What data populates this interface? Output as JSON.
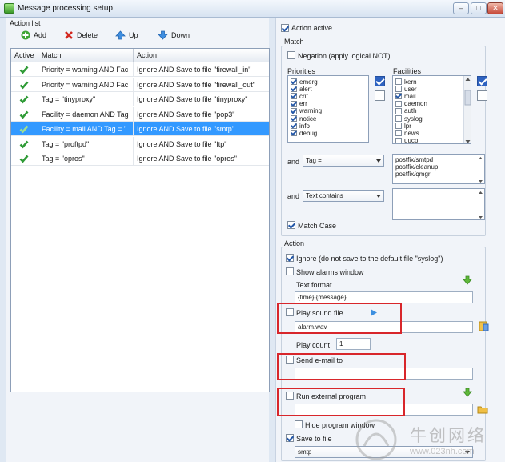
{
  "window": {
    "title": "Message processing setup",
    "min": "–",
    "max": "□",
    "close": "✕"
  },
  "left": {
    "section_label": "Action list",
    "toolbar": {
      "add": "Add",
      "delete": "Delete",
      "up": "Up",
      "down": "Down"
    },
    "columns": [
      "Active",
      "Match",
      "Action"
    ],
    "rows": [
      {
        "match": "Priority = warning AND Fac",
        "action": "Ignore AND Save to file \"firewall_in\"",
        "active": true,
        "selected": false
      },
      {
        "match": "Priority = warning AND Fac",
        "action": "Ignore AND Save to file \"firewall_out\"",
        "active": true,
        "selected": false
      },
      {
        "match": "Tag = \"tinyproxy\"",
        "action": "Ignore AND Save to file \"tinyproxy\"",
        "active": true,
        "selected": false
      },
      {
        "match": "Facility = daemon AND Tag",
        "action": "Ignore AND Save to file \"pop3\"",
        "active": true,
        "selected": false
      },
      {
        "match": "Facility = mail AND Tag = \"",
        "action": "Ignore AND Save to file \"smtp\"",
        "active": true,
        "selected": true
      },
      {
        "match": "Tag = \"proftpd\"",
        "action": "Ignore AND Save to file \"ftp\"",
        "active": true,
        "selected": false
      },
      {
        "match": "Tag = \"opros\"",
        "action": "Ignore AND Save to file \"opros\"",
        "active": true,
        "selected": false
      }
    ]
  },
  "right": {
    "action_active": "Action active",
    "match_label": "Match",
    "negation": "Negation (apply logical NOT)",
    "priorities_label": "Priorities",
    "priorities": [
      {
        "label": "emerg",
        "on": true
      },
      {
        "label": "alert",
        "on": true
      },
      {
        "label": "crit",
        "on": true
      },
      {
        "label": "err",
        "on": true
      },
      {
        "label": "warning",
        "on": true
      },
      {
        "label": "notice",
        "on": true
      },
      {
        "label": "info",
        "on": true
      },
      {
        "label": "debug",
        "on": true
      }
    ],
    "facilities_label": "Facilities",
    "facilities": [
      {
        "label": "kern",
        "on": false
      },
      {
        "label": "user",
        "on": false
      },
      {
        "label": "mail",
        "on": true
      },
      {
        "label": "daemon",
        "on": false
      },
      {
        "label": "auth",
        "on": false
      },
      {
        "label": "syslog",
        "on": false
      },
      {
        "label": "lpr",
        "on": false
      },
      {
        "label": "news",
        "on": false
      },
      {
        "label": "uucp",
        "on": false
      }
    ],
    "and1": "and",
    "tag_select": "Tag =",
    "tag_values": [
      "postfix/smtpd",
      "postfix/cleanup",
      "postfix/qmgr"
    ],
    "and2": "and",
    "text_select": "Text contains",
    "match_case": "Match Case",
    "action_label": "Action",
    "ignore": "Ignore (do not save to the default file \"syslog\")",
    "show_alarms": "Show alarms window",
    "text_format_label": "Text format",
    "text_format_value": "{time} {message}",
    "play_sound": "Play sound file",
    "sound_file": "alarm.wav",
    "play_count_label": "Play count",
    "play_count": "1",
    "send_email": "Send e-mail to",
    "run_program": "Run external program",
    "hide_window": "Hide program window",
    "save_to_file": "Save to file",
    "save_file_value": "smtp"
  },
  "watermark": {
    "text": "牛创网络",
    "url": "www.023nh.com"
  },
  "colors": {
    "selection": "#3399ff",
    "highlight_box": "#d8262b",
    "check_green": "#2f9b36"
  }
}
